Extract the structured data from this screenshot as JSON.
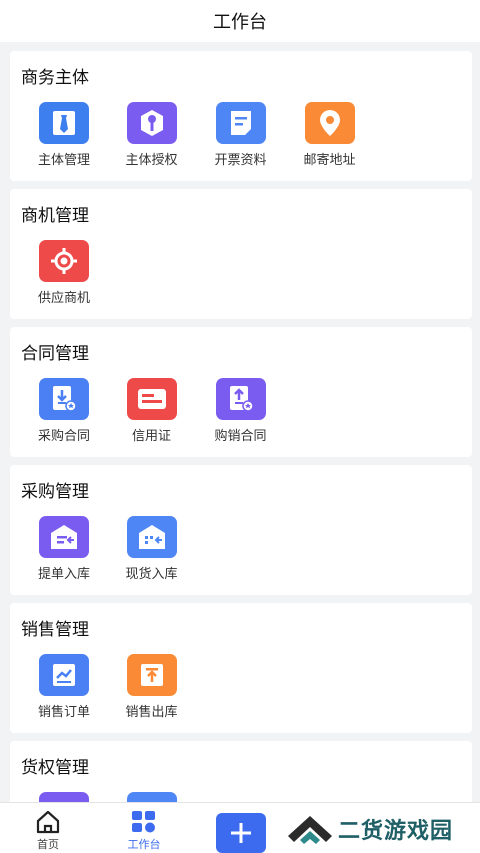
{
  "header": {
    "title": "工作台"
  },
  "sections": [
    {
      "title": "商务主体",
      "items": [
        {
          "label": "主体管理",
          "icon": "id-card-tie-icon",
          "color": "#3d7fef"
        },
        {
          "label": "主体授权",
          "icon": "key-hexagon-icon",
          "color": "#7b5cf0"
        },
        {
          "label": "开票资料",
          "icon": "document-lines-icon",
          "color": "#4f86f5"
        },
        {
          "label": "邮寄地址",
          "icon": "location-pin-icon",
          "color": "#fa8a35"
        }
      ]
    },
    {
      "title": "商机管理",
      "items": [
        {
          "label": "供应商机",
          "icon": "target-icon",
          "color": "#ef4a4a"
        }
      ]
    },
    {
      "title": "合同管理",
      "items": [
        {
          "label": "采购合同",
          "icon": "contract-download-icon",
          "color": "#4a80f3"
        },
        {
          "label": "信用证",
          "icon": "credit-card-icon",
          "color": "#ef4a4a"
        },
        {
          "label": "购销合同",
          "icon": "contract-upload-icon",
          "color": "#7b5cf0"
        }
      ]
    },
    {
      "title": "采购管理",
      "items": [
        {
          "label": "提单入库",
          "icon": "warehouse-in-icon",
          "color": "#7b5cf0"
        },
        {
          "label": "现货入库",
          "icon": "warehouse-spot-icon",
          "color": "#4f86f5"
        }
      ]
    },
    {
      "title": "销售管理",
      "items": [
        {
          "label": "销售订单",
          "icon": "sales-chart-icon",
          "color": "#4a80f3"
        },
        {
          "label": "销售出库",
          "icon": "outbound-icon",
          "color": "#fa8a35"
        }
      ]
    },
    {
      "title": "货权管理",
      "items": [
        {
          "label": "",
          "icon": "cargo-right-icon",
          "color": "#7b5cf0"
        },
        {
          "label": "",
          "icon": "cargo-right-icon",
          "color": "#4f86f5"
        }
      ]
    }
  ],
  "tabbar": {
    "home_label": "首页",
    "workbench_label": "工作台",
    "accent": "#3d6bef"
  },
  "watermark": {
    "text": "二货游戏园"
  }
}
